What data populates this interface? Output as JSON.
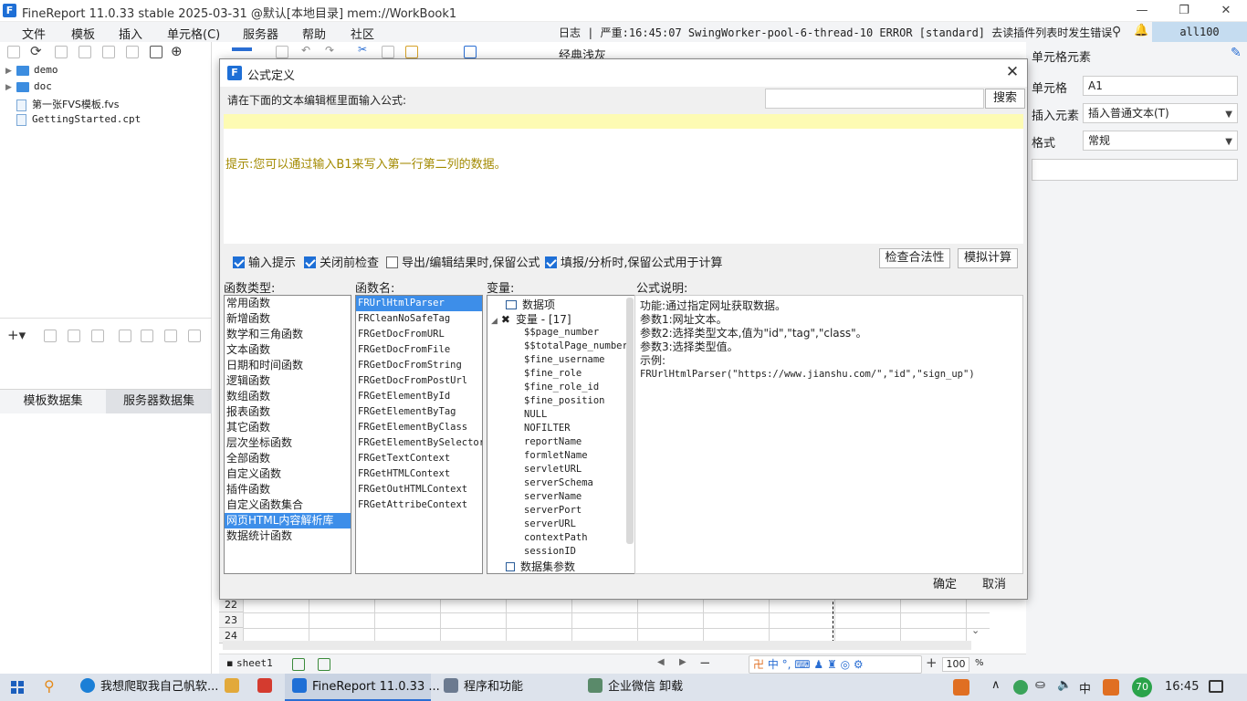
{
  "window": {
    "title": "FineReport 11.0.33 stable 2025-03-31 @默认[本地目录]     mem://WorkBook1",
    "minimize": "—",
    "restore": "❐",
    "close": "✕"
  },
  "menubar": {
    "items": [
      "文件",
      "模板",
      "插入",
      "单元格(C)",
      "服务器",
      "帮助",
      "社区"
    ],
    "log": "日志 | 严重:16:45:07 SwingWorker-pool-6-thread-10 ERROR [standard] 去读插件列表时发生错误",
    "user": "all100",
    "toolbar_label": "经典浅灰"
  },
  "left_panel": {
    "tree": [
      {
        "label": "demo",
        "type": "folder"
      },
      {
        "label": "doc",
        "type": "folder"
      },
      {
        "label": "第一张FVS模板.fvs",
        "type": "file"
      },
      {
        "label": "GettingStarted.cpt",
        "type": "file"
      }
    ],
    "tabs": [
      "模板数据集",
      "服务器数据集"
    ]
  },
  "right_panel": {
    "title": "单元格元素",
    "cell_label": "单元格",
    "cell_value": "A1",
    "insert_label": "插入元素",
    "insert_value": "插入普通文本(T)",
    "format_label": "格式",
    "format_value": "常规"
  },
  "grid": {
    "rows": [
      "22",
      "23",
      "24"
    ],
    "sheet_tab": "sheet1",
    "zoom": "100",
    "zoom_unit": "%"
  },
  "dialog": {
    "title": "公式定义",
    "prompt": "请在下面的文本编辑框里面输入公式:",
    "search_placeholder": "",
    "search_button": "搜索",
    "hint": "提示:您可以通过输入B1来写入第一行第二列的数据。",
    "checkboxes": [
      {
        "label": "输入提示",
        "checked": true
      },
      {
        "label": "关闭前检查",
        "checked": true
      },
      {
        "label": "导出/编辑结果时,保留公式",
        "checked": false
      },
      {
        "label": "填报/分析时,保留公式用于计算",
        "checked": true
      }
    ],
    "check_button": "检查合法性",
    "simulate_button": "模拟计算",
    "sections": {
      "func_type": "函数类型:",
      "func_name": "函数名:",
      "variables": "变量:",
      "description": "公式说明:"
    },
    "func_types": [
      "常用函数",
      "新增函数",
      "数学和三角函数",
      "文本函数",
      "日期和时间函数",
      "逻辑函数",
      "数组函数",
      "报表函数",
      "其它函数",
      "层次坐标函数",
      "全部函数",
      "自定义函数",
      "插件函数",
      "自定义函数集合",
      "网页HTML内容解析库",
      "数据统计函数"
    ],
    "func_type_selected": 14,
    "func_names": [
      "FRUrlHtmlParser",
      "FRCleanNoSafeTag",
      "FRGetDocFromURL",
      "FRGetDocFromFile",
      "FRGetDocFromString",
      "FRGetDocFromPostUrl",
      "FRGetElementById",
      "FRGetElementByTag",
      "FRGetElementByClass",
      "FRGetElementBySelector",
      "FRGetTextContext",
      "FRGetHTMLContext",
      "FRGetOutHTMLContext",
      "FRGetAttribeContext"
    ],
    "func_name_selected": 0,
    "var_tree": {
      "data_items": "数据项",
      "variables_group": "变量 - [17]",
      "variables": [
        "$$page_number",
        "$$totalPage_number",
        "$fine_username",
        "$fine_role",
        "$fine_role_id",
        "$fine_position",
        "NULL",
        "NOFILTER",
        "reportName",
        "formletName",
        "servletURL",
        "serverSchema",
        "serverName",
        "serverPort",
        "serverURL",
        "contextPath",
        "sessionID"
      ],
      "dataset_params": "数据集参数"
    },
    "description_lines": [
      "功能:通过指定网址获取数据。",
      "参数1:网址文本。",
      "参数2:选择类型文本,值为\"id\",\"tag\",\"class\"。",
      "参数3:选择类型值。",
      "示例:",
      "FRUrlHtmlParser(\"https://www.jianshu.com/\",\"id\",\"sign_up\")"
    ],
    "ok_button": "确定",
    "cancel_button": "取消"
  },
  "taskbar": {
    "apps": [
      {
        "label": "我想爬取我自己帆软...",
        "color": "#1b7fd6"
      },
      {
        "label": "",
        "color": "#e2a93b"
      },
      {
        "label": "",
        "color": "#d43b2f"
      },
      {
        "label": "FineReport 11.0.33 ...",
        "color": "#1e6fd6"
      },
      {
        "label": "程序和功能",
        "color": "#6b7a90"
      },
      {
        "label": "企业微信 卸载",
        "color": "#5a8a6a"
      }
    ],
    "tray_lang": "中",
    "badge": "70",
    "time": "16:45"
  }
}
